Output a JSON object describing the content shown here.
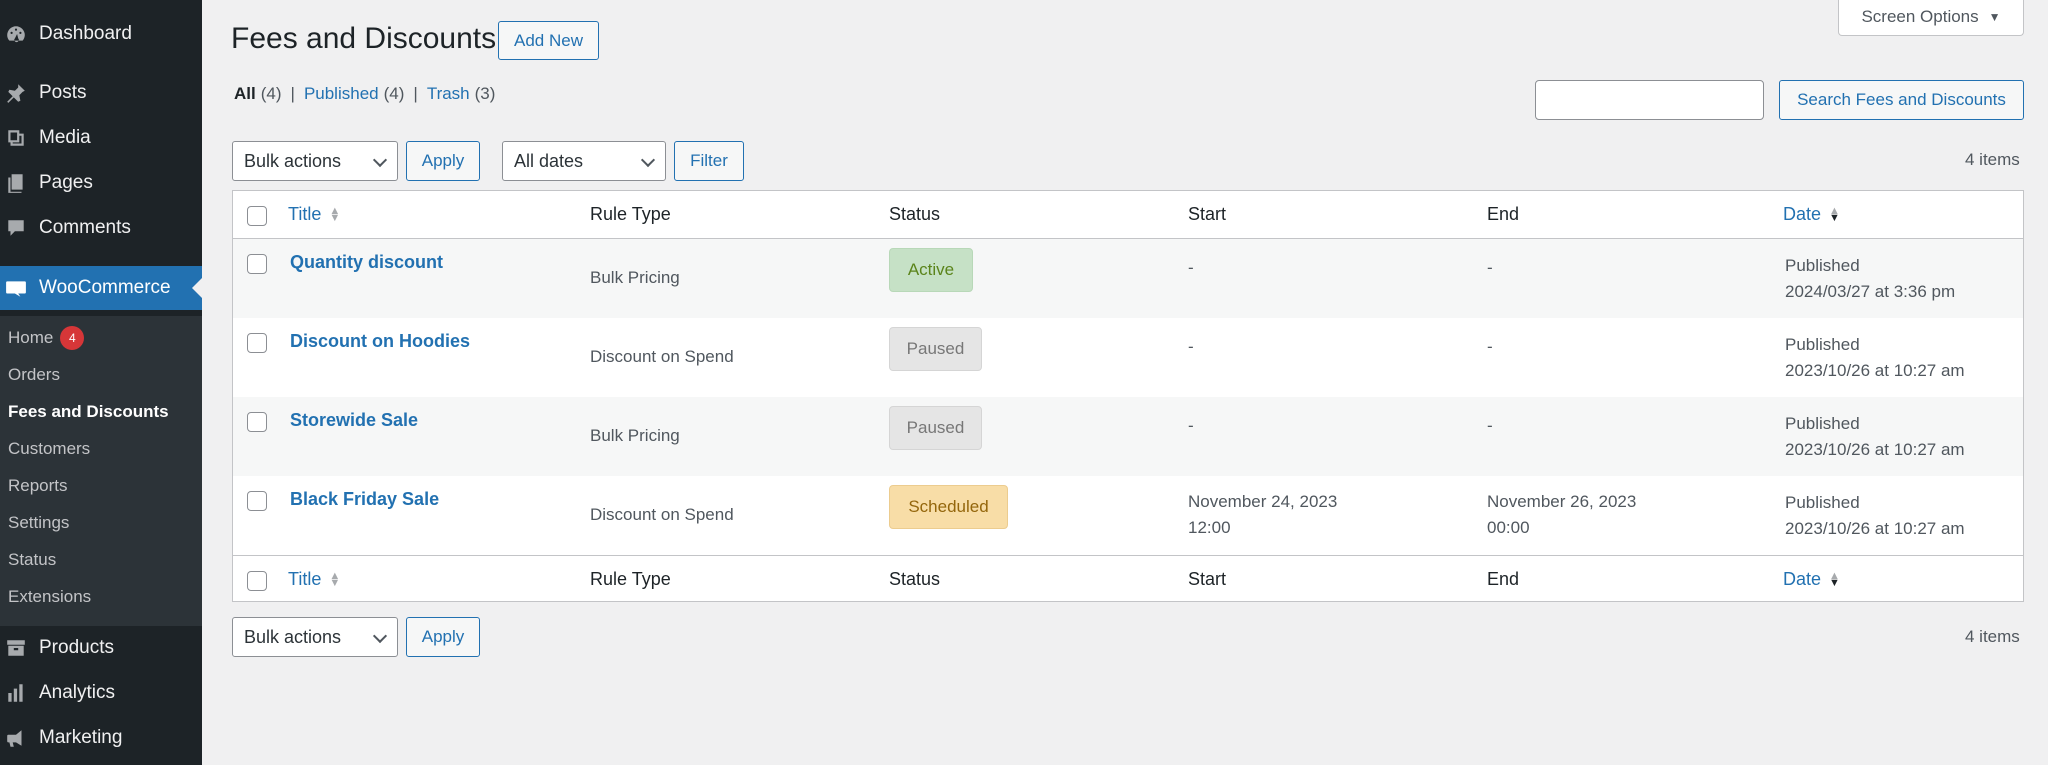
{
  "sidebar": {
    "items": [
      {
        "label": "Dashboard",
        "icon": "dashboard-icon"
      },
      {
        "label": "Posts",
        "icon": "pin-icon"
      },
      {
        "label": "Media",
        "icon": "media-icon"
      },
      {
        "label": "Pages",
        "icon": "pages-icon"
      },
      {
        "label": "Comments",
        "icon": "comment-icon"
      },
      {
        "label": "WooCommerce",
        "icon": "woo-icon"
      }
    ],
    "submenu": [
      {
        "label": "Home",
        "badge": "4"
      },
      {
        "label": "Orders"
      },
      {
        "label": "Fees and Discounts"
      },
      {
        "label": "Customers"
      },
      {
        "label": "Reports"
      },
      {
        "label": "Settings"
      },
      {
        "label": "Status"
      },
      {
        "label": "Extensions"
      }
    ],
    "bottom_items": [
      {
        "label": "Products",
        "icon": "archive-icon"
      },
      {
        "label": "Analytics",
        "icon": "bar-chart-icon"
      },
      {
        "label": "Marketing",
        "icon": "megaphone-icon"
      }
    ]
  },
  "header": {
    "title": "Fees and Discounts",
    "add_new": "Add New",
    "screen_options": "Screen Options",
    "screen_options_arrow": "▼"
  },
  "views": {
    "all": {
      "label": "All",
      "count": "(4)"
    },
    "published": {
      "label": "Published",
      "count": "(4)"
    },
    "trash": {
      "label": "Trash",
      "count": "(3)"
    },
    "separator": "|"
  },
  "search": {
    "button": "Search Fees and Discounts",
    "value": ""
  },
  "tablenav": {
    "bulk_actions": "Bulk actions",
    "apply": "Apply",
    "all_dates": "All dates",
    "filter": "Filter",
    "items_count": "4 items"
  },
  "table": {
    "columns": {
      "title": "Title",
      "rule_type": "Rule Type",
      "status": "Status",
      "start": "Start",
      "end": "End",
      "date": "Date"
    },
    "rows": [
      {
        "title": "Quantity discount",
        "rule_type": "Bulk Pricing",
        "status": "Active",
        "start1": "-",
        "start2": "",
        "end1": "-",
        "end2": "",
        "date1": "Published",
        "date2": "2024/03/27 at 3:36 pm"
      },
      {
        "title": "Discount on Hoodies",
        "rule_type": "Discount on Spend",
        "status": "Paused",
        "start1": "-",
        "start2": "",
        "end1": "-",
        "end2": "",
        "date1": "Published",
        "date2": "2023/10/26 at 10:27 am"
      },
      {
        "title": "Storewide Sale",
        "rule_type": "Bulk Pricing",
        "status": "Paused",
        "start1": "-",
        "start2": "",
        "end1": "-",
        "end2": "",
        "date1": "Published",
        "date2": "2023/10/26 at 10:27 am"
      },
      {
        "title": "Black Friday Sale",
        "rule_type": "Discount on Spend",
        "status": "Scheduled",
        "start1": "November 24, 2023",
        "start2": "12:00",
        "end1": "November 26, 2023",
        "end2": "00:00",
        "date1": "Published",
        "date2": "2023/10/26 at 10:27 am"
      }
    ]
  },
  "colors": {
    "sidebar_bg": "#1d2327",
    "accent": "#2271b1",
    "active_status": "#c6e1c6",
    "paused_status": "#e5e5e5",
    "scheduled_status": "#f8dda7",
    "badge": "#d63638"
  }
}
